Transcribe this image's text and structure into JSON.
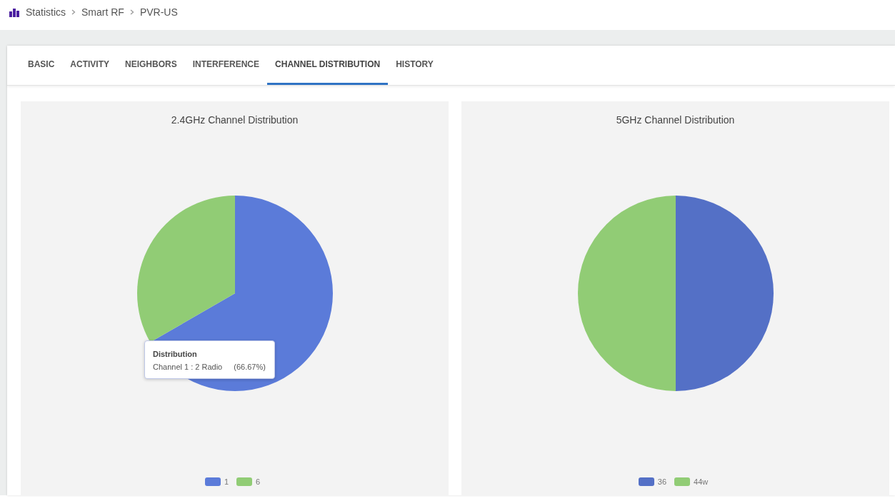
{
  "breadcrumb": [
    "Statistics",
    "Smart RF",
    "PVR-US"
  ],
  "tabs": [
    {
      "label": "BASIC",
      "selected": false
    },
    {
      "label": "ACTIVITY",
      "selected": false
    },
    {
      "label": "NEIGHBORS",
      "selected": false
    },
    {
      "label": "INTERFERENCE",
      "selected": false
    },
    {
      "label": "CHANNEL DISTRIBUTION",
      "selected": true
    },
    {
      "label": "HISTORY",
      "selected": false
    }
  ],
  "charts": [
    {
      "tooltip": {
        "label": "Channel 1 : 2 Radio",
        "percent": "(66.67%)"
      },
      "chart_data": {
        "type": "pie",
        "title": "2.4GHz Channel Distribution",
        "categories": [
          "1",
          "6"
        ],
        "series": [
          {
            "name": "Distribution",
            "values": [
              66.67,
              33.33
            ]
          }
        ],
        "colors": [
          "#5b7bd9",
          "#91cc75"
        ]
      }
    },
    {
      "chart_data": {
        "type": "pie",
        "title": "5GHz Channel Distribution",
        "categories": [
          "36",
          "44w"
        ],
        "series": [
          {
            "values": [
              50,
              50
            ]
          }
        ],
        "colors": [
          "#5470c6",
          "#91cc75"
        ]
      }
    }
  ]
}
